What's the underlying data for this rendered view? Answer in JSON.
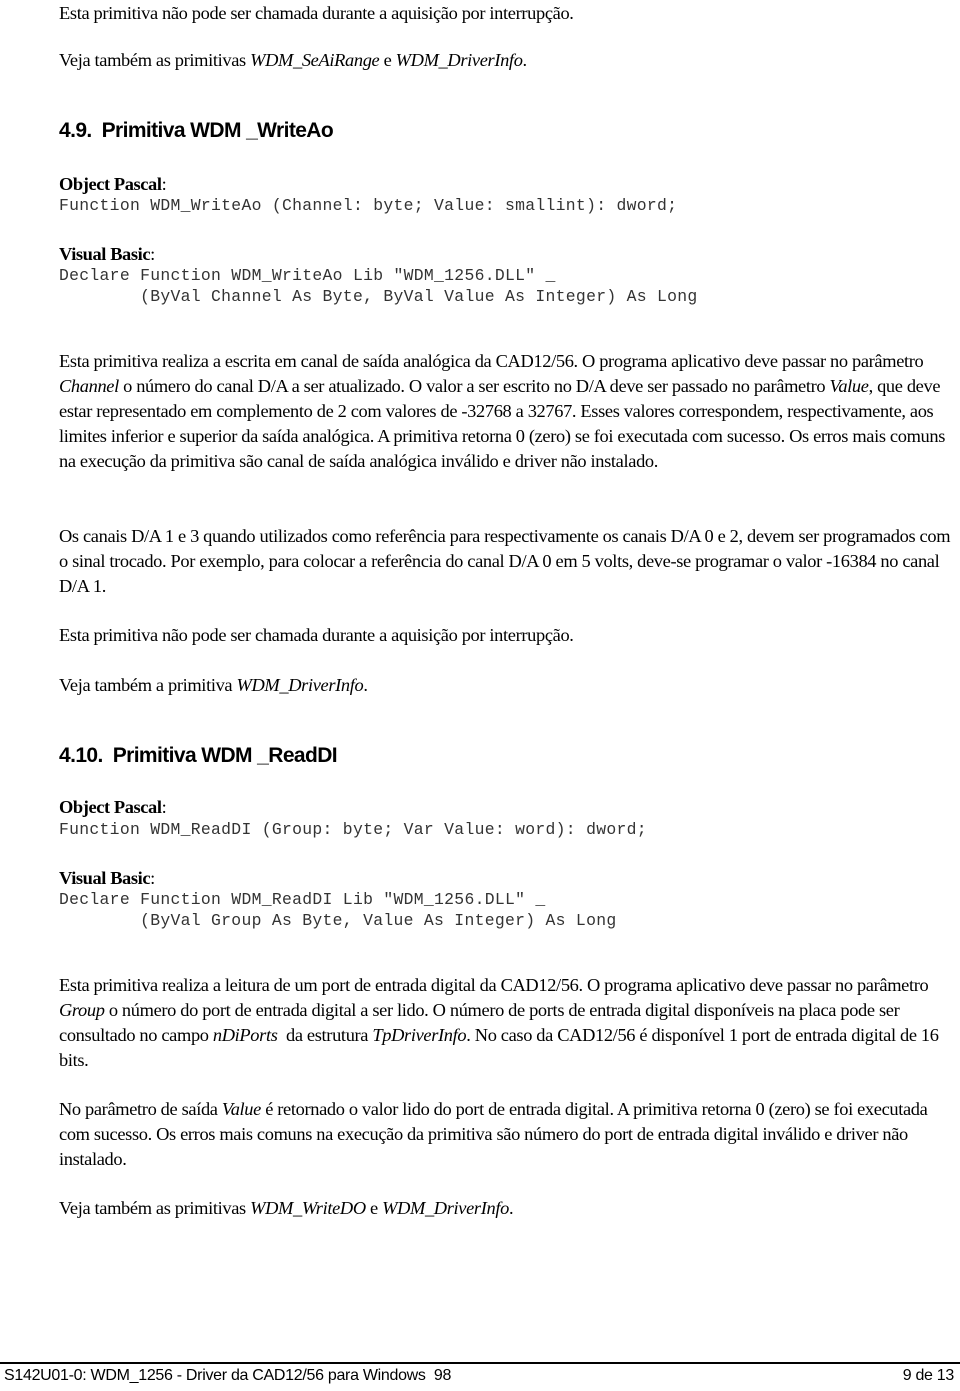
{
  "top": {
    "note": "Esta primitiva não pode ser chamada durante a aquisição por interrupção.",
    "see_also_prefix": "Veja também as primitivas ",
    "see_also_ref1": "WDM_SeAiRange",
    "see_also_mid": " e ",
    "see_also_ref2": "WDM_DriverInfo",
    "see_also_suffix": "."
  },
  "section_49": {
    "number": "4.9.",
    "title": "Primitiva WDM _WriteAo",
    "pascal_label": "Object Pascal",
    "pascal_code": "Function WDM_WriteAo (Channel: byte; Value: smallint): dword;",
    "vb_label": "Visual Basic",
    "vb_code_line1": "Declare Function WDM_WriteAo Lib \"WDM_1256.DLL\" _",
    "vb_code_line2": "        (ByVal Channel As Byte, ByVal Value As Integer) As Long",
    "para1": {
      "t1": "Esta primitiva realiza a escrita em canal de saída analógica da CAD12/56. O programa aplicativo deve passar no parâmetro ",
      "i1": "Channel",
      "t2": " o número do canal D/A a ser atualizado. O valor a ser escrito no D/A deve ser passado no parâmetro ",
      "i2": "Value",
      "t3": ", que deve estar representado em complemento de 2 com valores de -32768 a 32767. Esses valores correspondem, respectivamente, aos limites inferior e superior da saída analógica. A primitiva retorna 0 (zero) se foi executada com sucesso. Os erros mais comuns na execução da primitiva são canal de saída analógica inválido e driver não instalado."
    },
    "para2": "Os canais D/A 1 e 3 quando utilizados como referência para respectivamente os canais D/A 0 e 2, devem ser programados com o sinal trocado. Por exemplo, para colocar a referência do canal D/A 0 em 5 volts, deve-se programar o valor -16384 no canal D/A 1.",
    "note": "Esta primitiva não pode ser chamada durante a aquisição por interrupção.",
    "see_also_prefix": "Veja também a primitiva ",
    "see_also_ref1": "WDM_DriverInfo",
    "see_also_suffix": "."
  },
  "section_410": {
    "number": "4.10.",
    "title": "Primitiva WDM _ReadDI",
    "pascal_label": "Object Pascal",
    "pascal_code": "Function WDM_ReadDI (Group: byte; Var Value: word): dword;",
    "vb_label": "Visual Basic",
    "vb_code_line1": "Declare Function WDM_ReadDI Lib \"WDM_1256.DLL\" _",
    "vb_code_line2": "        (ByVal Group As Byte, Value As Integer) As Long",
    "para1": {
      "t1": "Esta primitiva realiza a leitura de um port de entrada digital da CAD12/56. O programa aplicativo deve passar no parâmetro ",
      "i1": "Group",
      "t2": " o número do port de entrada digital a ser lido. O número de ports de entrada digital disponíveis na placa pode ser consultado no campo ",
      "i2": "nDiPorts",
      "t3": "  da estrutura ",
      "i3": "TpDriverInfo",
      "t4": ". No caso da CAD12/56 é disponível 1 port de entrada digital de 16 bits."
    },
    "para2": {
      "t1": "No parâmetro de saída ",
      "i1": "Value",
      "t2": " é retornado o valor lido do port de entrada digital. A primitiva retorna 0 (zero) se foi executada com sucesso. Os erros mais comuns na execução da primitiva são número do port de entrada digital inválido e driver não instalado."
    },
    "see_also_prefix": "Veja também as primitivas ",
    "see_also_ref1": "WDM_WriteDO",
    "see_also_mid": " e ",
    "see_also_ref2": "WDM_DriverInfo",
    "see_also_suffix": "."
  },
  "footer": {
    "left": "S142U01-0: WDM_1256 - Driver da CAD12/56 para Windows  98",
    "right": "9 de 13"
  },
  "colon": ":"
}
